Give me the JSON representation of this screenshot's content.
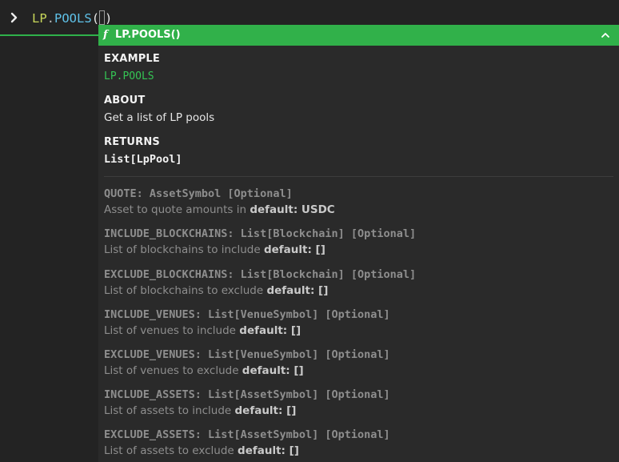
{
  "command": {
    "namespace": "LP",
    "dot": ".",
    "function": "POOLS",
    "open_paren": "(",
    "close_paren": ")"
  },
  "popup": {
    "header_title": "LP.POOLS()",
    "fn_glyph": "f",
    "example_heading": "EXAMPLE",
    "example_value": "LP.POOLS",
    "about_heading": "ABOUT",
    "about_text": "Get a list of LP pools",
    "returns_heading": "RETURNS",
    "returns_value": "List[LpPool]",
    "params": [
      {
        "signature": "QUOTE: AssetSymbol [Optional]",
        "description": "Asset to quote amounts in",
        "default": "default: USDC"
      },
      {
        "signature": "INCLUDE_BLOCKCHAINS: List[Blockchain] [Optional]",
        "description": "List of blockchains to include",
        "default": "default: []"
      },
      {
        "signature": "EXCLUDE_BLOCKCHAINS: List[Blockchain] [Optional]",
        "description": "List of blockchains to exclude",
        "default": "default: []"
      },
      {
        "signature": "INCLUDE_VENUES: List[VenueSymbol] [Optional]",
        "description": "List of venues to include",
        "default": "default: []"
      },
      {
        "signature": "EXCLUDE_VENUES: List[VenueSymbol] [Optional]",
        "description": "List of venues to exclude",
        "default": "default: []"
      },
      {
        "signature": "INCLUDE_ASSETS: List[AssetSymbol] [Optional]",
        "description": "List of assets to include",
        "default": "default: []"
      },
      {
        "signature": "EXCLUDE_ASSETS: List[AssetSymbol] [Optional]",
        "description": "List of assets to exclude",
        "default": "default: []"
      }
    ]
  },
  "colors": {
    "background": "#232323",
    "popup_background": "#2a2a2a",
    "header_green": "#31b14a",
    "example_green": "#35c454",
    "namespace_yellow": "#c8d75a",
    "function_blue": "#5fc1e8"
  },
  "icons": {
    "prompt": "chevron-right-icon",
    "collapse": "chevron-up-icon",
    "function": "function-icon"
  }
}
